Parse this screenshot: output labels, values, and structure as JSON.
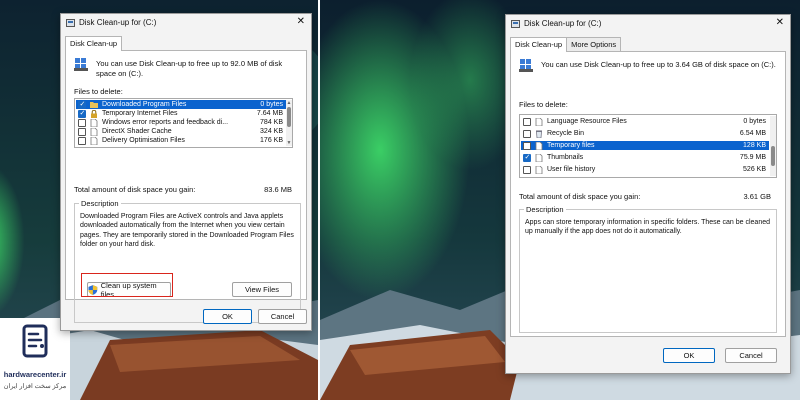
{
  "colors": {
    "selection": "#0b63ce",
    "highlight": "#d9251c",
    "accent": "#0067c0"
  },
  "watermark": {
    "site": "hardwarecenter.ir",
    "tagline": "مرکز سخت افزار ایران"
  },
  "left_dialog": {
    "title": "Disk Clean-up for  (C:)",
    "tabs": [
      {
        "label": "Disk Clean-up",
        "active": true
      }
    ],
    "intro": "You can use Disk Clean-up to free up to 92.0 MB of disk space on  (C:).",
    "files_label": "Files to delete:",
    "files": [
      {
        "name": "Downloaded Program Files",
        "size": "0 bytes",
        "checked": true,
        "selected": true,
        "icon": "folder-icon"
      },
      {
        "name": "Temporary Internet Files",
        "size": "7.64 MB",
        "checked": true,
        "selected": false,
        "icon": "lock-icon"
      },
      {
        "name": "Windows error reports and feedback di...",
        "size": "784 KB",
        "checked": false,
        "selected": false,
        "icon": "file-icon"
      },
      {
        "name": "DirectX Shader Cache",
        "size": "324 KB",
        "checked": false,
        "selected": false,
        "icon": "file-icon"
      },
      {
        "name": "Delivery Optimisation Files",
        "size": "176 KB",
        "checked": false,
        "selected": false,
        "icon": "file-icon"
      }
    ],
    "total_label": "Total amount of disk space you gain:",
    "total_value": "83.6 MB",
    "description_label": "Description",
    "description": "Downloaded Program Files are ActiveX controls and Java applets downloaded automatically from the Internet when you view certain pages. They are temporarily stored in the Downloaded Program Files folder on your hard disk.",
    "cleanup_button": "Clean up system files",
    "view_files_button": "View Files",
    "ok": "OK",
    "cancel": "Cancel"
  },
  "right_dialog": {
    "title": "Disk Clean-up for  (C:)",
    "tabs": [
      {
        "label": "Disk Clean-up",
        "active": true
      },
      {
        "label": "More Options",
        "active": false
      }
    ],
    "intro": "You can use Disk Clean-up to free up to 3.64 GB of disk space on  (C:).",
    "files_label": "Files to delete:",
    "files": [
      {
        "name": "Language Resource Files",
        "size": "0 bytes",
        "checked": false,
        "selected": false,
        "icon": "file-icon"
      },
      {
        "name": "Recycle Bin",
        "size": "6.54 MB",
        "checked": false,
        "selected": false,
        "icon": "recycle-bin-icon"
      },
      {
        "name": "Temporary files",
        "size": "128 KB",
        "checked": false,
        "selected": true,
        "icon": "file-icon"
      },
      {
        "name": "Thumbnails",
        "size": "75.9 MB",
        "checked": true,
        "selected": false,
        "icon": "file-icon"
      },
      {
        "name": "User file history",
        "size": "526 KB",
        "checked": false,
        "selected": false,
        "icon": "file-icon"
      }
    ],
    "total_label": "Total amount of disk space you gain:",
    "total_value": "3.61 GB",
    "description_label": "Description",
    "description": "Apps can store temporary information in specific folders. These can be cleaned up manually if the app does not do it automatically.",
    "ok": "OK",
    "cancel": "Cancel"
  }
}
